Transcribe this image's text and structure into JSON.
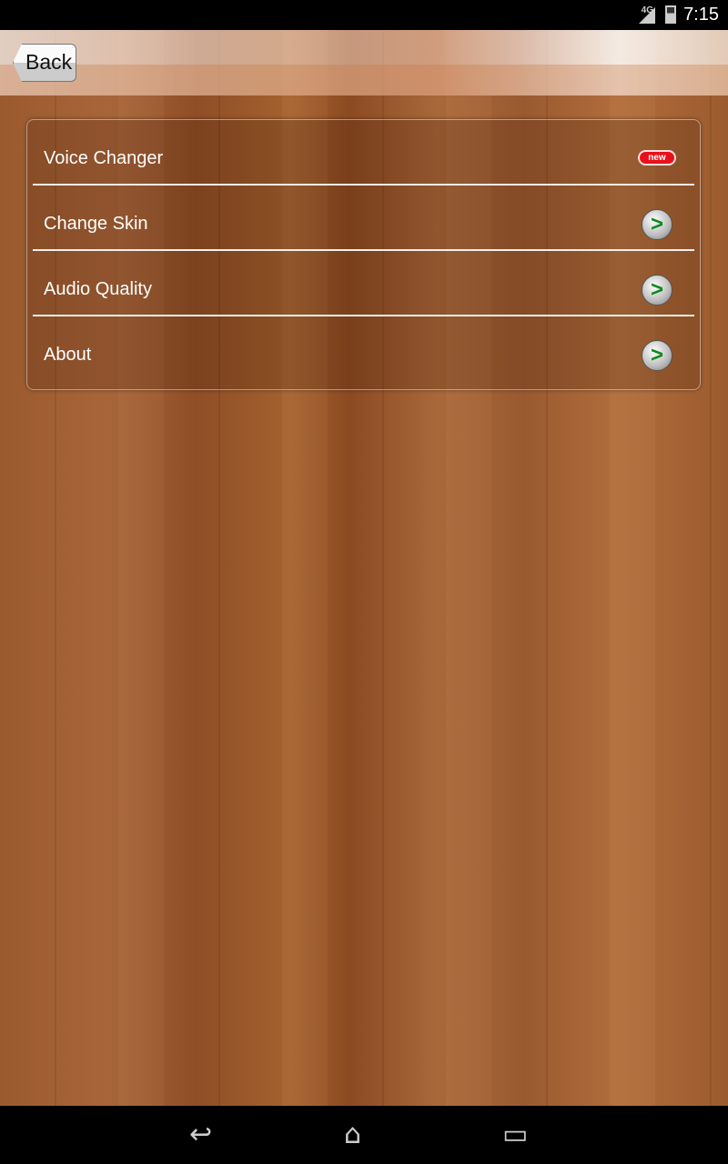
{
  "status_bar": {
    "network": "4G",
    "time": "7:15"
  },
  "header": {
    "back_label": "Back"
  },
  "menu": {
    "items": [
      {
        "label": "Voice Changer",
        "badge": "new"
      },
      {
        "label": "Change Skin",
        "icon": "arrow-right-icon"
      },
      {
        "label": "Audio Quality",
        "icon": "arrow-right-icon"
      },
      {
        "label": "About",
        "icon": "arrow-right-icon"
      }
    ]
  },
  "nav": {
    "back": "↩",
    "home": "⌂",
    "recents": "▭"
  }
}
